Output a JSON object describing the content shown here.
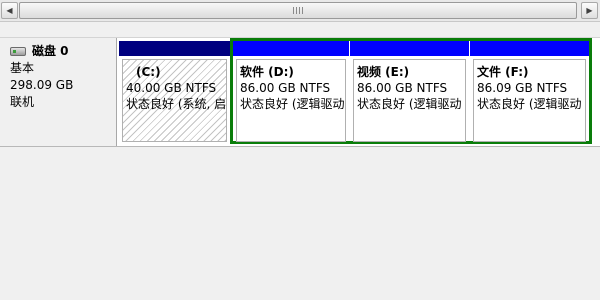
{
  "disk": {
    "name": "磁盘 0",
    "type": "基本",
    "size": "298.09 GB",
    "status": "联机"
  },
  "partitions": [
    {
      "name": "(C:)",
      "size": "40.00 GB NTFS",
      "status": "状态良好 (系统, 启"
    },
    {
      "name": "软件  (D:)",
      "size": "86.00 GB NTFS",
      "status": "状态良好 (逻辑驱动"
    },
    {
      "name": "视频  (E:)",
      "size": "86.00 GB NTFS",
      "status": "状态良好 (逻辑驱动"
    },
    {
      "name": "文件  (F:)",
      "size": "86.09 GB NTFS",
      "status": "状态良好 (逻辑驱动"
    }
  ],
  "colors": {
    "primary_partition": "#00007f",
    "logical_drive": "#0000ff",
    "extended_partition": "#0a7d0a"
  }
}
